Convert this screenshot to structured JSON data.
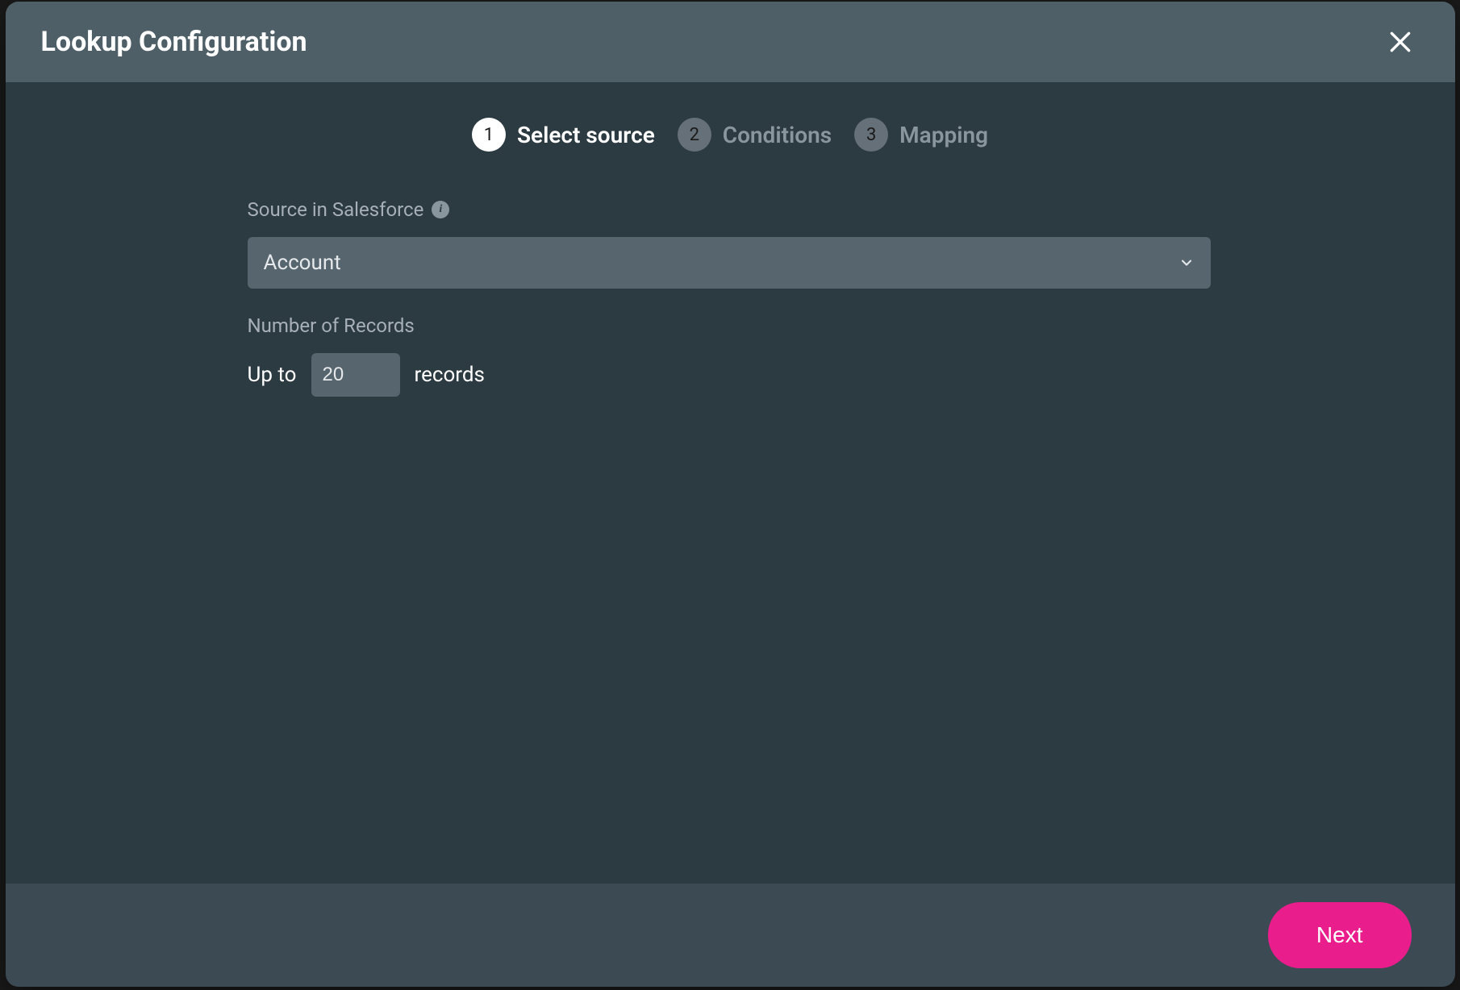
{
  "modal": {
    "title": "Lookup Configuration"
  },
  "stepper": {
    "steps": [
      {
        "number": "1",
        "label": "Select source",
        "active": true
      },
      {
        "number": "2",
        "label": "Conditions",
        "active": false
      },
      {
        "number": "3",
        "label": "Mapping",
        "active": false
      }
    ]
  },
  "form": {
    "source_label": "Source in Salesforce",
    "source_value": "Account",
    "records_label": "Number of Records",
    "records_prefix": "Up to",
    "records_value": "20",
    "records_suffix": "records"
  },
  "footer": {
    "next_label": "Next"
  }
}
